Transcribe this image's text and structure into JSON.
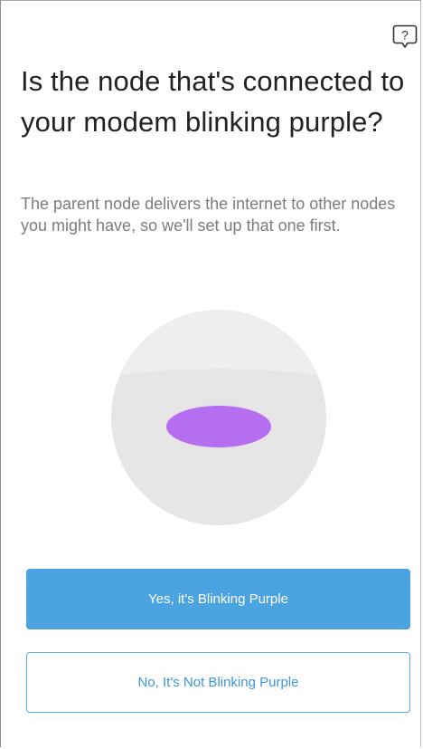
{
  "header": {
    "help_icon": "question-bubble-icon"
  },
  "content": {
    "title": "Is the node that's connected to your modem blinking purple?",
    "description": "The parent node delivers the internet to other nodes you might have, so we'll set up that one first."
  },
  "illustration": {
    "light_color": "#b66ef0",
    "node_color": "#e6e6e6"
  },
  "actions": {
    "yes_label": "Yes, it's Blinking Purple",
    "no_label": "No, It's Not Blinking Purple"
  },
  "colors": {
    "accent": "#4ba3e0",
    "title_text": "#222222",
    "body_text": "#7c7c7c"
  }
}
